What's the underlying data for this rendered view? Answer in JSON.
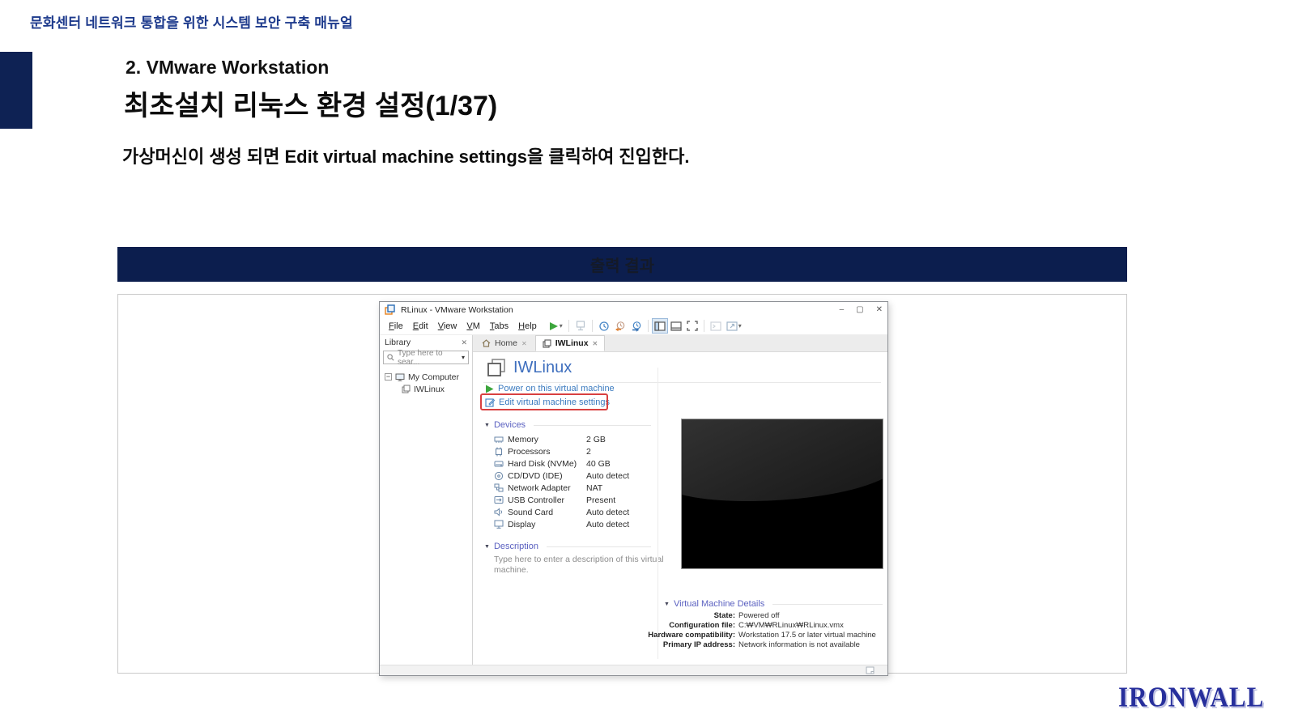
{
  "doc": {
    "header_title": "문화센터 네트워크 통합을 위한 시스템 보안 구축 매뉴얼",
    "section_label": "2. VMware Workstation",
    "page_title": "최초설치 리눅스 환경 설정(1/37)",
    "instruction": "가상머신이 생성 되면 Edit virtual machine settings을 클릭하여 진입한다.",
    "banner_label": "출력 결과",
    "logo_text": "IRONWALL"
  },
  "icons": {
    "minimize": "–",
    "maximize": "▢",
    "close": "✕",
    "caret_down": "▾",
    "collapse_triangle": "▼",
    "tree_expander": "−",
    "tab_close": "✕",
    "panel_close": "✕"
  },
  "vmware": {
    "window_title": "RLinux - VMware Workstation",
    "menu": [
      "File",
      "Edit",
      "View",
      "VM",
      "Tabs",
      "Help"
    ],
    "library": {
      "title": "Library",
      "search_placeholder": "Type here to sear...",
      "tree_root": "My Computer",
      "tree_child": "IWLinux"
    },
    "tabs": {
      "home": "Home",
      "vm": "IWLinux"
    },
    "vm_name": "IWLinux",
    "commands": {
      "power_on": "Power on this virtual machine",
      "edit_settings": "Edit virtual machine settings"
    },
    "devices": {
      "title": "Devices",
      "rows": [
        {
          "name": "Memory",
          "value": "2 GB"
        },
        {
          "name": "Processors",
          "value": "2"
        },
        {
          "name": "Hard Disk (NVMe)",
          "value": "40 GB"
        },
        {
          "name": "CD/DVD (IDE)",
          "value": "Auto detect"
        },
        {
          "name": "Network Adapter",
          "value": "NAT"
        },
        {
          "name": "USB Controller",
          "value": "Present"
        },
        {
          "name": "Sound Card",
          "value": "Auto detect"
        },
        {
          "name": "Display",
          "value": "Auto detect"
        }
      ]
    },
    "description": {
      "title": "Description",
      "placeholder": "Type here to enter a description of this virtual machine."
    },
    "details": {
      "title": "Virtual Machine Details",
      "rows": [
        {
          "label": "State:",
          "value": "Powered off"
        },
        {
          "label": "Configuration file:",
          "value": "C:₩VM₩RLinux₩RLinux.vmx"
        },
        {
          "label": "Hardware compatibility:",
          "value": "Workstation 17.5 or later virtual machine"
        },
        {
          "label": "Primary IP address:",
          "value": "Network information is not available"
        }
      ]
    }
  },
  "colors": {
    "navy_block": "#0e2254",
    "banner_bg": "#0c1e4e",
    "header_blue": "#1d3a8c",
    "link_blue": "#3a7abf",
    "section_blue": "#5a60c0",
    "annotation_red": "#d84040",
    "play_green": "#3da63d",
    "logo_navy": "#272f9c"
  }
}
